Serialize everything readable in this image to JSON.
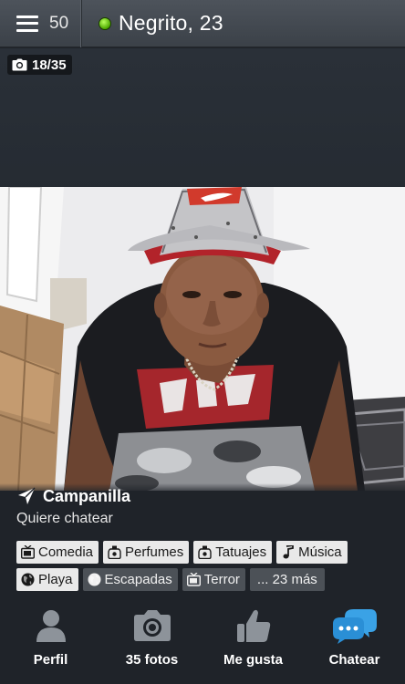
{
  "header": {
    "menu_count": "50",
    "title": "Negrito, 23",
    "online_color": "#5cc80c"
  },
  "photo": {
    "counter": "18/35"
  },
  "profile": {
    "location": "Campanilla",
    "status": "Quiere chatear"
  },
  "interests": [
    {
      "label": "Comedia",
      "icon": "tv-icon",
      "style": "light"
    },
    {
      "label": "Perfumes",
      "icon": "perfume-icon",
      "style": "light"
    },
    {
      "label": "Tatuajes",
      "icon": "perfume-icon",
      "style": "light"
    },
    {
      "label": "Música",
      "icon": "music-note-icon",
      "style": "light"
    },
    {
      "label": "Playa",
      "icon": "globe-icon",
      "style": "light"
    },
    {
      "label": "Escapadas",
      "icon": "globe-icon",
      "style": "dark"
    },
    {
      "label": "Terror",
      "icon": "tv-icon",
      "style": "dark"
    }
  ],
  "more_interests": "... 23 más",
  "nav": {
    "profile_label": "Perfil",
    "photos_label": "35 fotos",
    "like_label": "Me gusta",
    "chat_label": "Chatear",
    "accent_color": "#2a8fd6",
    "icon_color": "#8d939a"
  }
}
